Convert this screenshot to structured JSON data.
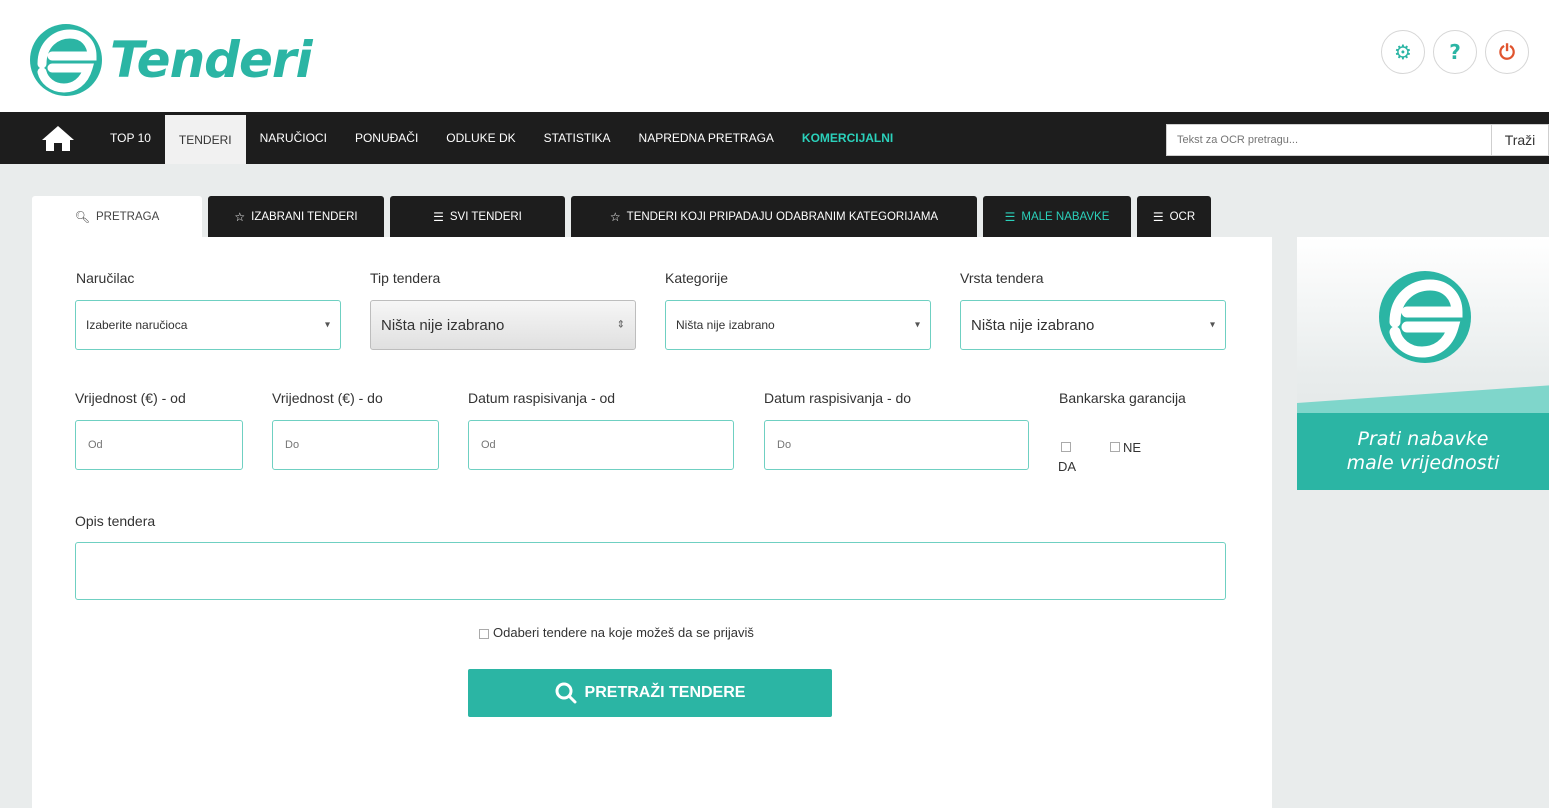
{
  "brand": {
    "name": "Tenderi",
    "accent": "#2bb5a4",
    "dark": "#1d1d1d",
    "power_color": "#e0542e"
  },
  "header_icons": [
    {
      "name": "settings-icon",
      "glyph": "⚙"
    },
    {
      "name": "help-icon",
      "glyph": "?"
    },
    {
      "name": "power-icon",
      "glyph": "⏻"
    }
  ],
  "nav": {
    "items": [
      "TOP 10",
      "TENDERI",
      "NARUČIOCI",
      "PONUĐAČI",
      "ODLUKE DK",
      "STATISTIKA",
      "NAPREDNA PRETRAGA",
      "KOMERCIJALNI"
    ],
    "active": "TENDERI",
    "ocr_placeholder": "Tekst za OCR pretragu...",
    "search_label": "Traži"
  },
  "tabs": [
    {
      "icon": "search-icon",
      "label": "PRETRAGA",
      "active": true
    },
    {
      "icon": "star-icon",
      "label": "IZABRANI TENDERI"
    },
    {
      "icon": "list-icon",
      "label": "SVI TENDERI"
    },
    {
      "icon": "star-icon",
      "label": "TENDERI KOJI PRIPADAJU ODABRANIM KATEGORIJAMA"
    },
    {
      "icon": "list-icon",
      "label": "MALE NABAVKE"
    },
    {
      "icon": "list-icon",
      "label": "OCR"
    }
  ],
  "form": {
    "narucilac_label": "Naručilac",
    "narucilac_value": "Izaberite naručioca",
    "tip_label": "Tip tendera",
    "tip_value": "Ništa nije izabrano",
    "kategorije_label": "Kategorije",
    "kategorije_value": "Ništa nije izabrano",
    "vrsta_label": "Vrsta tendera",
    "vrsta_value": "Ništa nije izabrano",
    "vrijednost_od_label": "Vrijednost (€) - od",
    "vrijednost_od_placeholder": "Od",
    "vrijednost_do_label": "Vrijednost (€) - do",
    "vrijednost_do_placeholder": "Do",
    "datum_od_label": "Datum raspisivanja - od",
    "datum_od_placeholder": "Od",
    "datum_do_label": "Datum raspisivanja - do",
    "datum_do_placeholder": "Do",
    "garancija_label": "Bankarska garancija",
    "garancija_da": "DA",
    "garancija_ne": "NE",
    "opis_label": "Opis tendera",
    "prijava_checkbox_label": "Odaberi tendere na koje možeš da se prijaviš",
    "submit_label": "PRETRAŽI TENDERE"
  },
  "banner": {
    "line1": "Prati nabavke",
    "line2": "male vrijednosti"
  }
}
